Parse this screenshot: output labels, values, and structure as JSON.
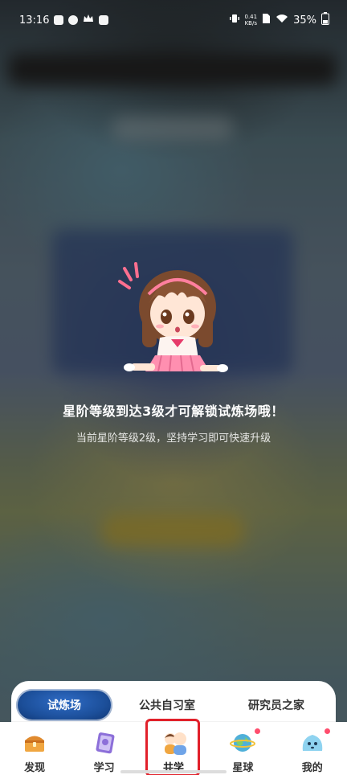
{
  "status_bar": {
    "time": "13:16",
    "net_speed_value": "0.41",
    "net_speed_unit": "KB/s",
    "battery": "35%"
  },
  "locked": {
    "title": "星阶等级到达3级才可解锁试炼场哦！",
    "subtitle": "当前星阶等级2级，坚持学习即可快速升级"
  },
  "segments": [
    {
      "label": "试炼场",
      "active": true
    },
    {
      "label": "公共自习室",
      "active": false
    },
    {
      "label": "研究员之家",
      "active": false
    }
  ],
  "bottom_nav": [
    {
      "label": "发现",
      "icon": "treasure-chest-icon",
      "active": false,
      "badge": false
    },
    {
      "label": "学习",
      "icon": "book-icon",
      "active": false,
      "badge": false
    },
    {
      "label": "共学",
      "icon": "study-buddies-icon",
      "active": true,
      "badge": false
    },
    {
      "label": "星球",
      "icon": "planet-icon",
      "active": false,
      "badge": true
    },
    {
      "label": "我的",
      "icon": "blob-avatar-icon",
      "active": false,
      "badge": true
    }
  ],
  "colors": {
    "accent": "#2f6fd6",
    "highlight": "#e1202a",
    "badge": "#ff4d6d"
  }
}
